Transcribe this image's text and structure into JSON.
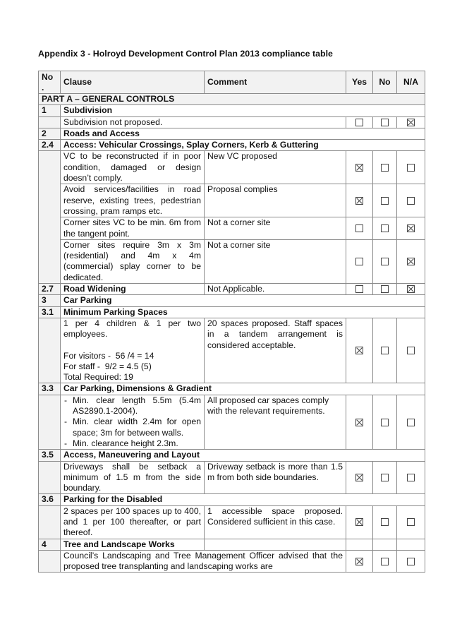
{
  "document": {
    "title": "Appendix 3 - Holroyd Development Control Plan 2013 compliance table"
  },
  "table": {
    "headers": {
      "no": "No .",
      "clause": "Clause",
      "comment": "Comment",
      "yes": "Yes",
      "no_col": "No",
      "na": "N/A"
    },
    "part_a": "PART A – GENERAL CONTROLS",
    "s1": {
      "no": "1",
      "heading": "Subdivision",
      "row": {
        "clause": "Subdivision not proposed.",
        "status": "na"
      }
    },
    "s2": {
      "no": "2",
      "heading": "Roads and Access"
    },
    "s2_4": {
      "no": "2.4",
      "heading": "Access: Vehicular Crossings, Splay Corners, Kerb & Guttering",
      "rows": [
        {
          "clause": "VC to be reconstructed if in poor condition, damaged or design doesn’t comply.",
          "comment": "New VC proposed",
          "status": "yes"
        },
        {
          "clause": "Avoid services/facilities in road reserve, existing trees, pedestrian crossing, pram ramps etc.",
          "comment": "Proposal complies",
          "status": "yes"
        },
        {
          "clause": "Corner sites VC to be min. 6m from the tangent point.",
          "comment": "Not a corner site",
          "status": "na"
        },
        {
          "clause": "Corner sites require 3m x 3m (residential) and 4m x 4m (commercial) splay corner to be dedicated.",
          "comment": "Not a corner site",
          "status": "na"
        }
      ]
    },
    "s2_7": {
      "no": "2.7",
      "heading": "Road Widening",
      "comment": "Not Applicable.",
      "status": "na"
    },
    "s3": {
      "no": "3",
      "heading": "Car Parking"
    },
    "s3_1": {
      "no": "3.1",
      "heading": "Minimum Parking Spaces",
      "clause_lines": [
        "1 per 4 children & 1 per two employees.",
        "For visitors -  56 /4 = 14",
        "For staff -  9/2 = 4.5 (5)",
        "Total Required: 19"
      ],
      "comment": "20 spaces proposed. Staff spaces in a tandem arrangement is considered acceptable.",
      "status": "yes"
    },
    "s3_3": {
      "no": "3.3",
      "heading": "Car Parking, Dimensions & Gradient",
      "clause_items": [
        "Min. clear length 5.5m (5.4m AS2890.1-2004).",
        "Min. clear width 2.4m for open space; 3m for between walls.",
        "Min. clearance height 2.3m."
      ],
      "comment": "All proposed car spaces comply with the relevant requirements.",
      "status": "yes"
    },
    "s3_5": {
      "no": "3.5",
      "heading": "Access, Maneuvering and Layout",
      "clause": "Driveways shall be setback a minimum of 1.5 m from the side boundary.",
      "comment": "Driveway setback is more than 1.5 m from both side boundaries.",
      "status": "yes"
    },
    "s3_6": {
      "no": "3.6",
      "heading": "Parking for the Disabled",
      "clause": "2 spaces per 100 spaces up to 400, and 1 per 100 thereafter, or part thereof.",
      "comment": "1 accessible space proposed. Considered sufficient in this case.",
      "status": "yes"
    },
    "s4": {
      "no": "4",
      "heading": "Tree and Landscape Works",
      "text": "Council’s Landscaping and Tree Management Officer advised that the proposed tree transplanting and landscaping works are",
      "status": "yes"
    }
  }
}
